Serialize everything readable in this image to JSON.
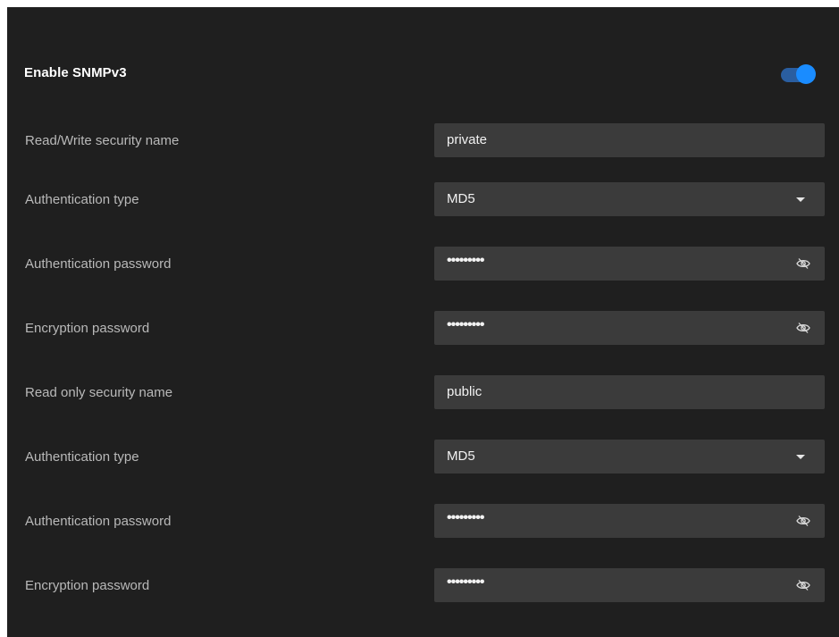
{
  "header": {
    "title": "Enable SNMPv3",
    "toggle_on": true,
    "toggle_color": "#1a8cff"
  },
  "rows": [
    {
      "label": "Read/Write security name",
      "type": "text",
      "value": "private"
    },
    {
      "label": "Authentication type",
      "type": "select",
      "value": "MD5"
    },
    {
      "label": "Authentication password",
      "type": "password",
      "value": "•••••••••"
    },
    {
      "label": "Encryption password",
      "type": "password",
      "value": "•••••••••"
    },
    {
      "label": "Read only security name",
      "type": "text",
      "value": "public"
    },
    {
      "label": "Authentication type",
      "type": "select",
      "value": "MD5"
    },
    {
      "label": "Authentication password",
      "type": "password",
      "value": "•••••••••"
    },
    {
      "label": "Encryption password",
      "type": "password",
      "value": "•••••••••"
    }
  ],
  "icons": {
    "select": "chevron-down-icon",
    "password": "eye-slash-icon"
  },
  "colors": {
    "panel_bg": "#1f1f1f",
    "field_bg": "#3b3b3b",
    "label_text": "#b9b9b9",
    "accent": "#1a8cff"
  }
}
